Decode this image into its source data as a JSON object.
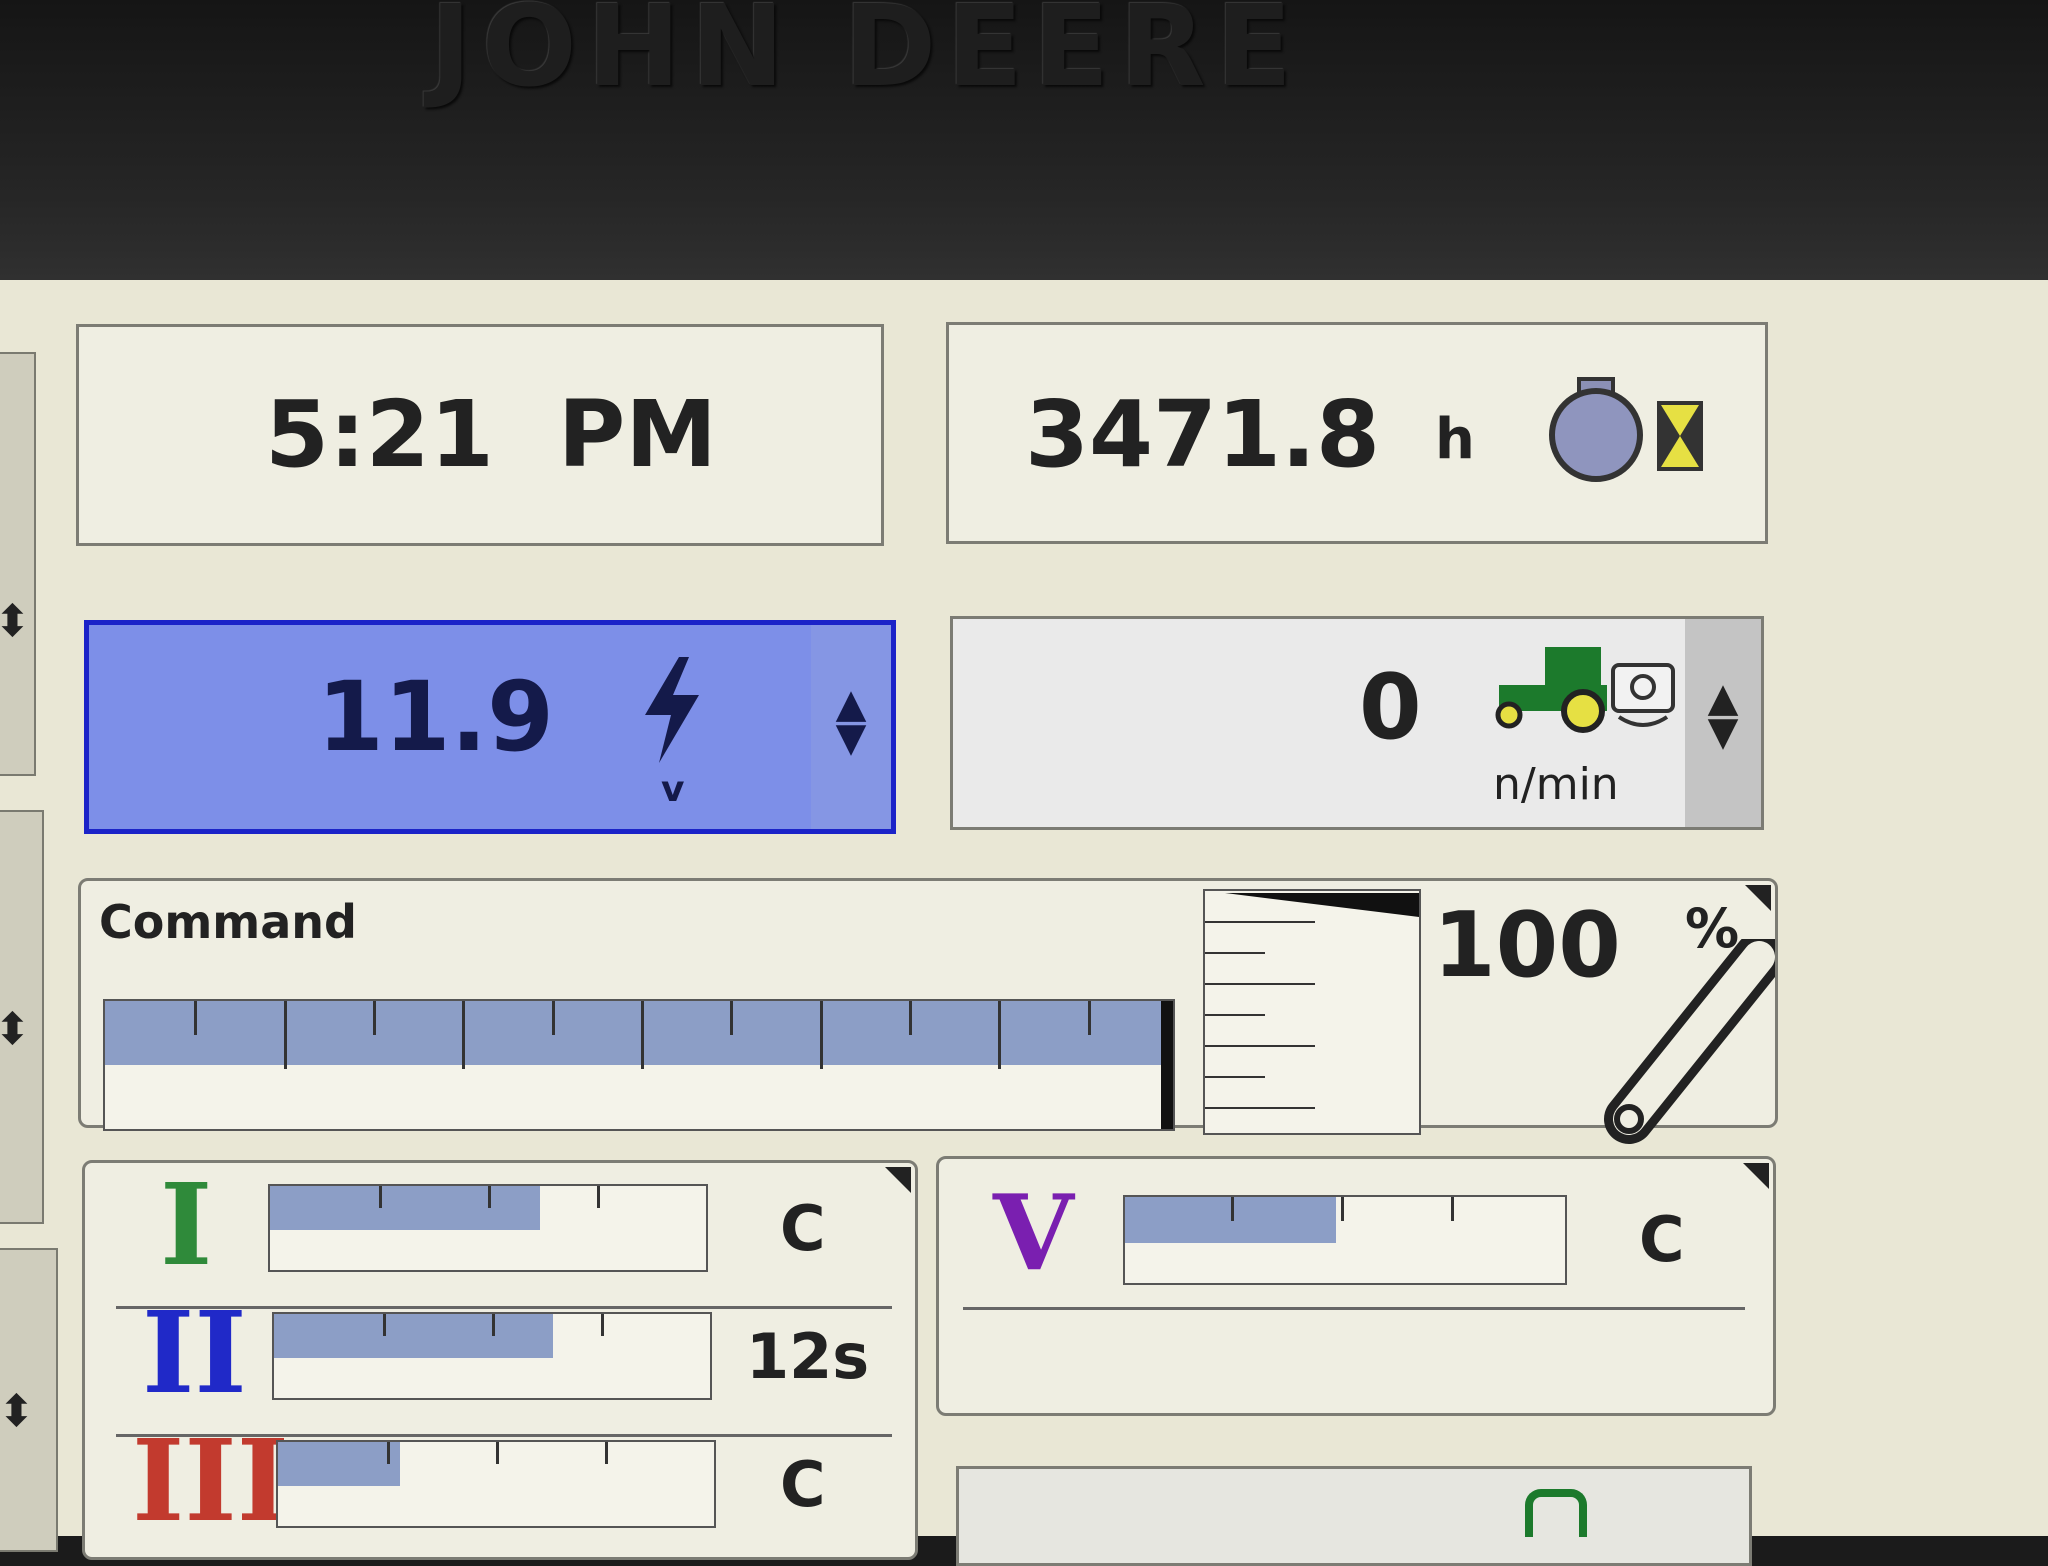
{
  "bezel": {
    "brand": "JOHN DEERE"
  },
  "clock": {
    "time": "5:21  PM"
  },
  "engine_hours": {
    "value": "3471.8",
    "unit": "h",
    "icon": "engine-hours-icon"
  },
  "voltage": {
    "value": "11.9",
    "unit": "v",
    "icon": "lightning-icon",
    "highlight_color": "#7d8fe8"
  },
  "pto_speed": {
    "value": "0",
    "unit": "n/min",
    "icon": "tractor-pto-icon"
  },
  "command": {
    "label": "Command",
    "bar_level": 0.99,
    "percent": "100",
    "percent_sign": "%",
    "icon": "wrench-icon"
  },
  "scvs": [
    {
      "numeral": "I",
      "color": "#2f8a3a",
      "level": 0.62,
      "status": "C"
    },
    {
      "numeral": "II",
      "color": "#2029c8",
      "level": 0.64,
      "status": "12s"
    },
    {
      "numeral": "III",
      "color": "#c23a2e",
      "level": 0.28,
      "status": "C"
    }
  ],
  "scv_v": {
    "numeral": "V",
    "color": "#7a1fb0",
    "level": 0.48,
    "status": "C"
  }
}
